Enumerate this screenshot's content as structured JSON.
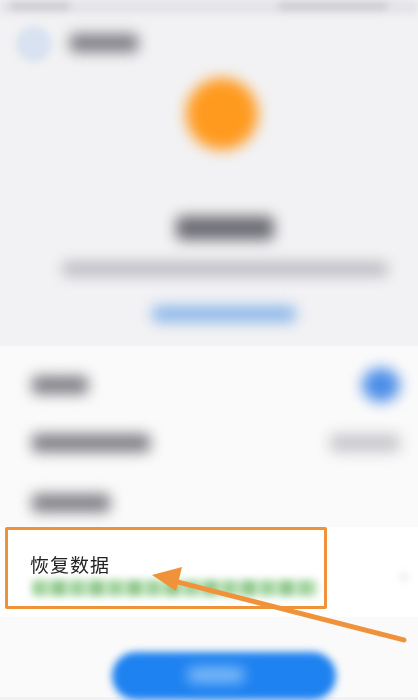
{
  "restore_data": {
    "title": "恢复数据"
  },
  "annotation": {
    "highlight_color": "#f0923a"
  },
  "colors": {
    "accent_orange": "#ff9a1f",
    "primary_blue": "#1e82f0",
    "toggle_blue": "#4d8ee8"
  },
  "icons": {
    "back": "back-icon",
    "hero": "hero-icon",
    "toggle": "toggle-switch",
    "chevron": "chevron-right-icon",
    "pointer": "arrow-pointer"
  }
}
